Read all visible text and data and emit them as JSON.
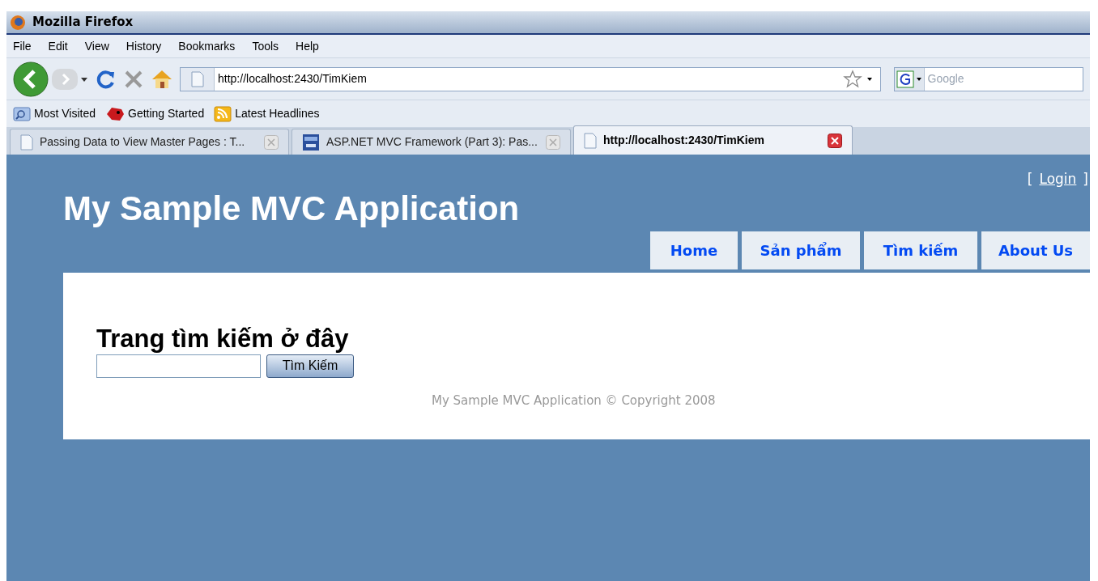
{
  "window": {
    "title": "Mozilla Firefox"
  },
  "menu": [
    "File",
    "Edit",
    "View",
    "History",
    "Bookmarks",
    "Tools",
    "Help"
  ],
  "toolbar": {
    "url": "http://localhost:2430/TimKiem",
    "search_placeholder": "Google"
  },
  "bookmarks": [
    {
      "label": "Most Visited",
      "kind": "folder"
    },
    {
      "label": "Getting Started",
      "kind": "start"
    },
    {
      "label": "Latest Headlines",
      "kind": "feed"
    }
  ],
  "tabs": [
    {
      "label": "Passing Data to View Master Pages : T...",
      "kind": "page",
      "selected": false
    },
    {
      "label": "ASP.NET MVC Framework (Part 3): Pas...",
      "kind": "aspnet",
      "selected": false
    },
    {
      "label": "http://localhost:2430/TimKiem",
      "kind": "page",
      "selected": true
    }
  ],
  "page": {
    "login_open": "[",
    "login": "Login",
    "login_close": "]",
    "site_title": "My Sample MVC Application",
    "nav": [
      "Home",
      "Sản phẩm",
      "Tìm kiếm",
      "About Us"
    ],
    "heading": "Trang tìm kiếm ở đây",
    "search_button": "Tìm Kiếm",
    "footer": "My Sample MVC Application © Copyright 2008"
  }
}
